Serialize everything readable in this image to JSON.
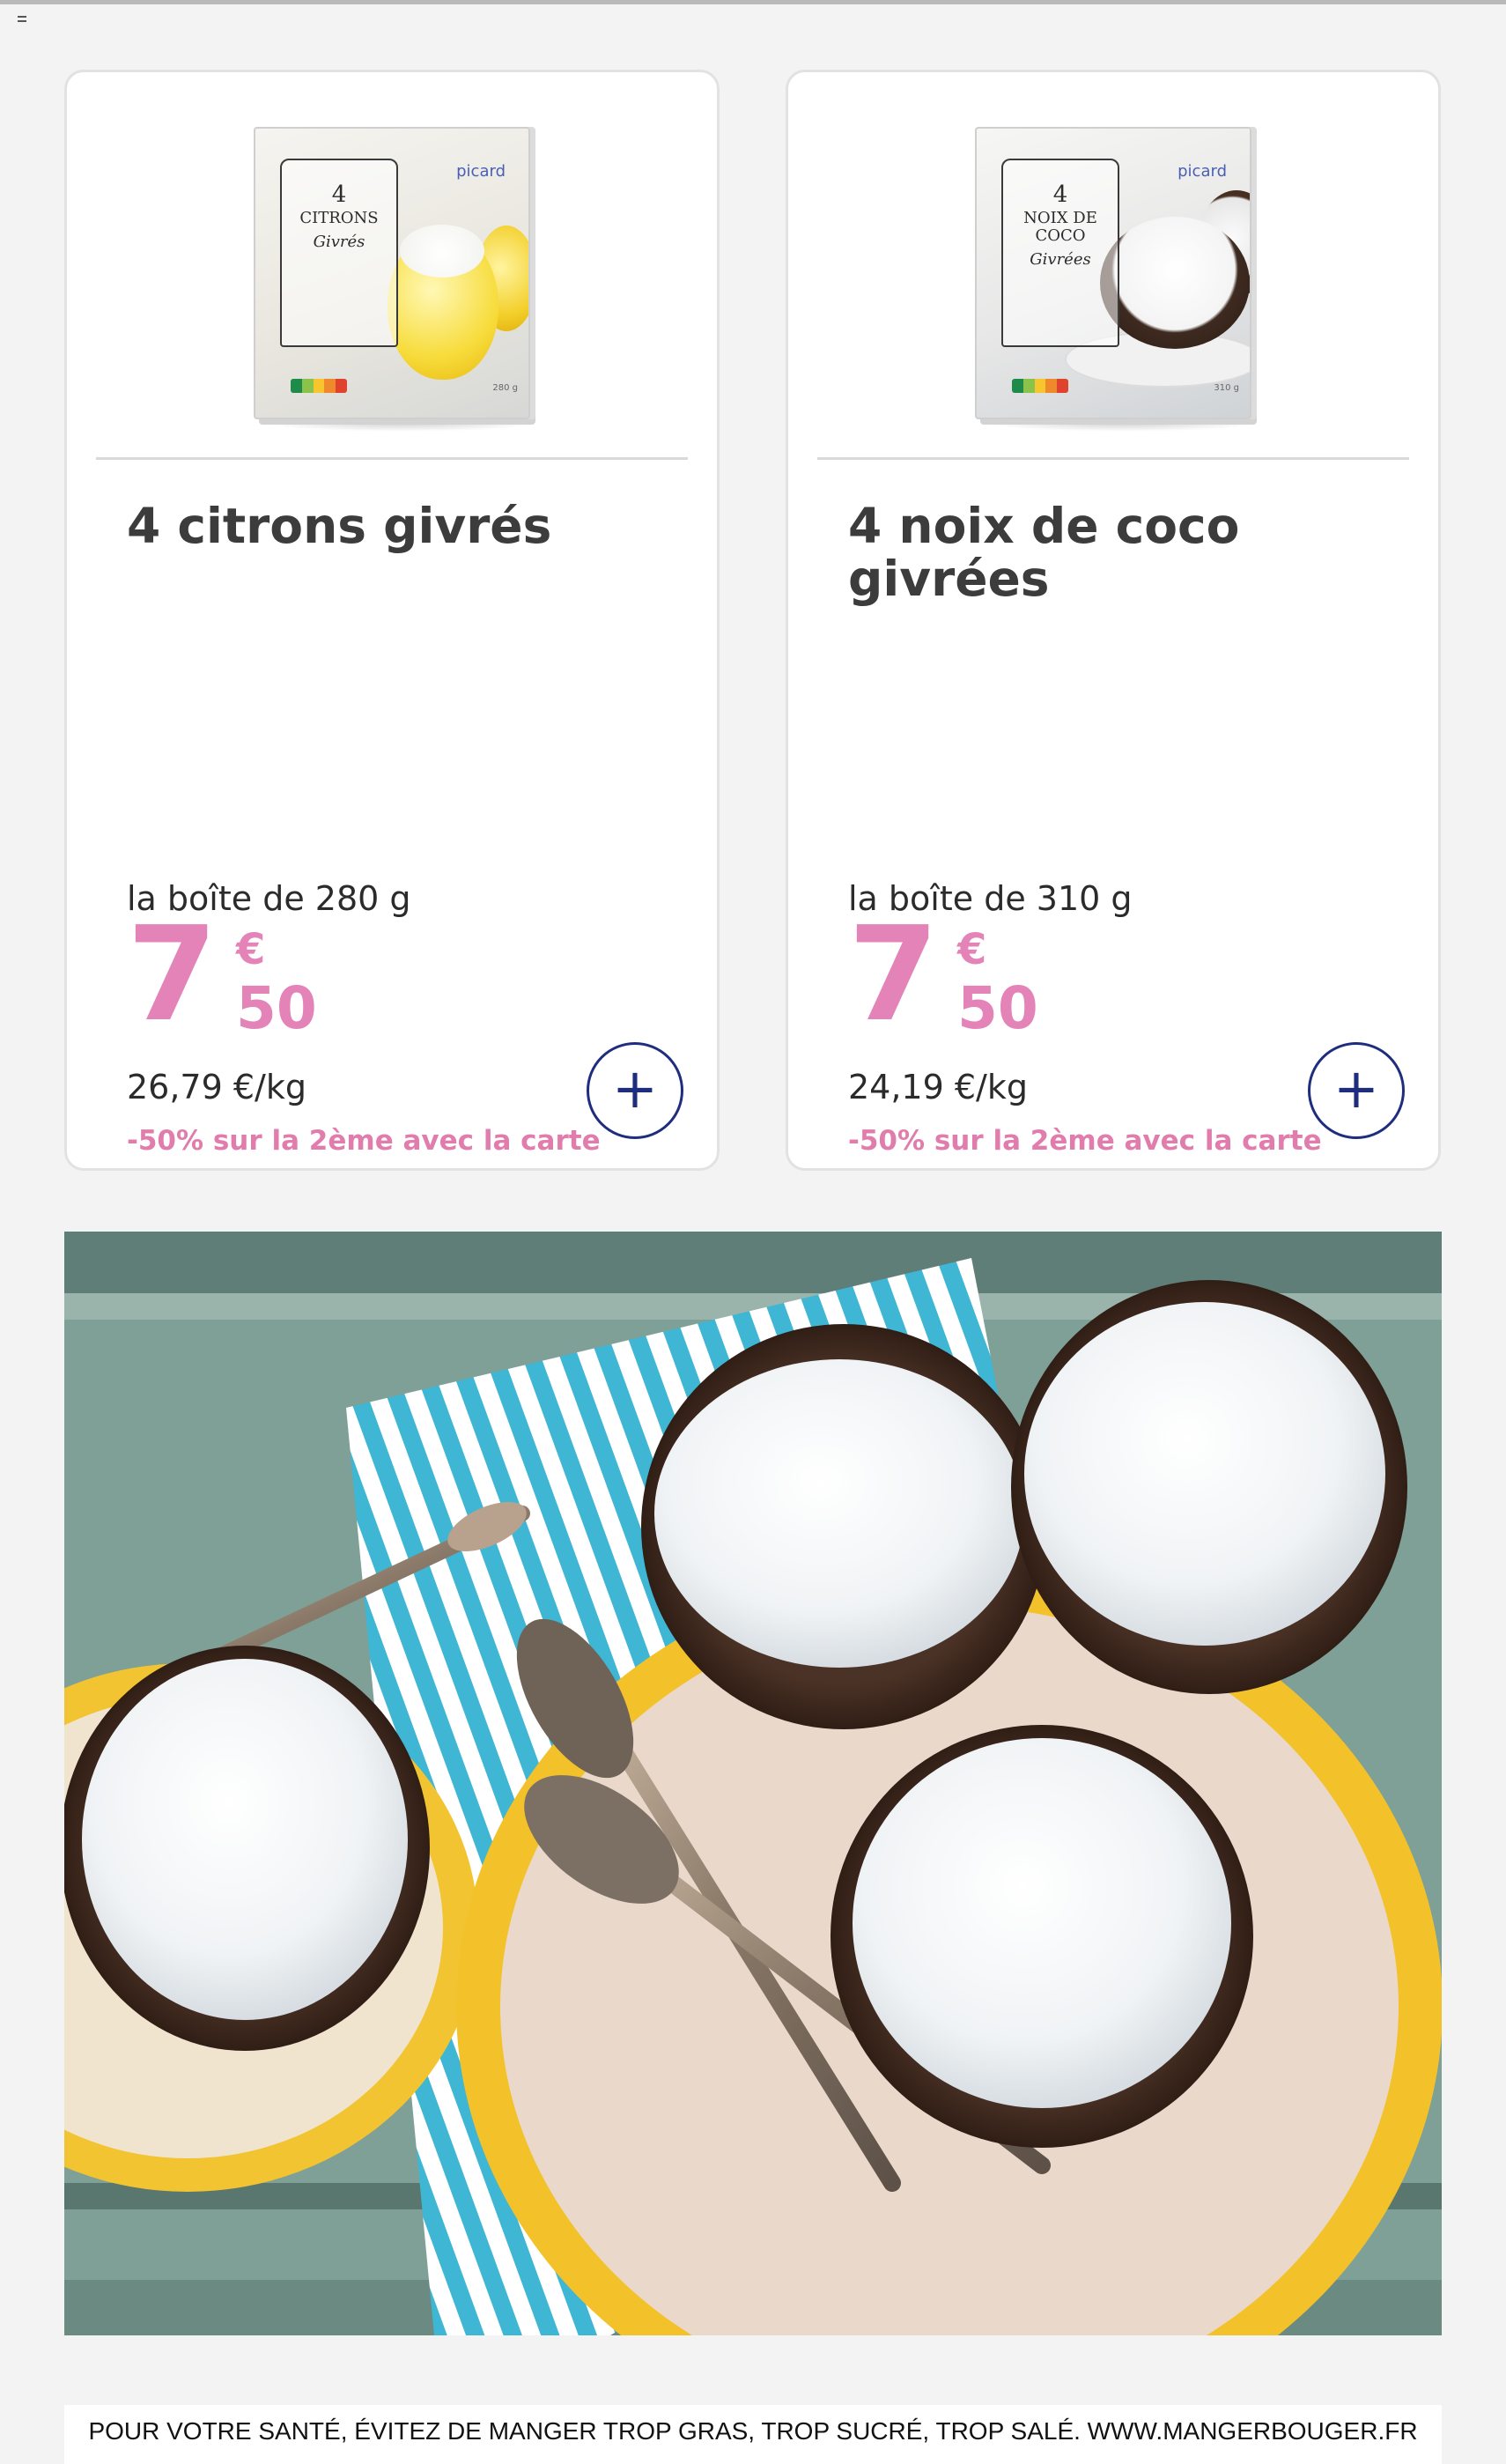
{
  "products": [
    {
      "name": "4 citrons givrés",
      "pack_size": "la boîte de 280 g",
      "price_int": "7",
      "price_currency": "€",
      "price_dec": "50",
      "price_per_kg": "26,79 €/kg",
      "promo": "-50% sur la 2ème avec la carte",
      "add_label": "+",
      "package": {
        "brand": "picard",
        "count": "4",
        "title": "CITRONS",
        "subtitle": "Givrés",
        "weight": "280 g"
      }
    },
    {
      "name": "4 noix de coco givrées",
      "pack_size": "la boîte de 310 g",
      "price_int": "7",
      "price_currency": "€",
      "price_dec": "50",
      "price_per_kg": "24,19 €/kg",
      "promo": "-50% sur la 2ème avec la carte",
      "add_label": "+",
      "package": {
        "brand": "picard",
        "count": "4",
        "title": "NOIX DE COCO",
        "subtitle": "Givrées",
        "weight": "310 g"
      }
    }
  ],
  "footer": {
    "text": "POUR VOTRE SANTÉ, ÉVITEZ DE MANGER TROP GRAS, TROP SUCRÉ, TROP SALÉ. WWW.MANGERBOUGER.FR"
  },
  "colors": {
    "accent_pink": "#e383b8",
    "promo_pink": "#e17dac",
    "button_navy": "#1f2d7e",
    "text_dark": "#3c3c3c"
  }
}
